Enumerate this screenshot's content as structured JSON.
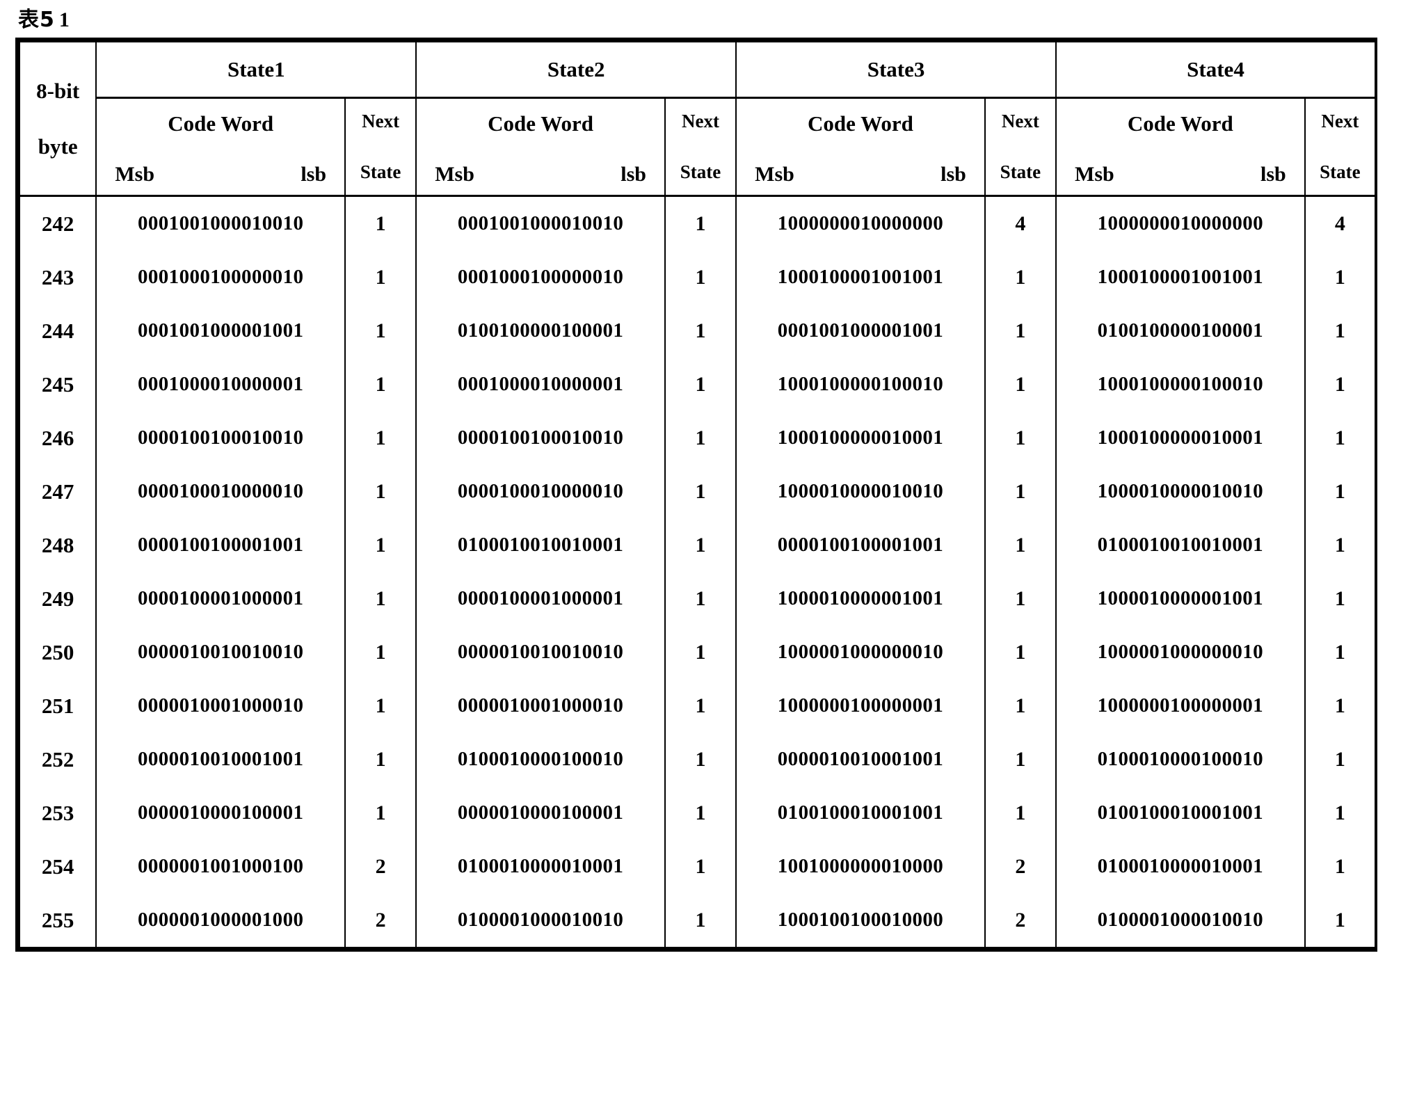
{
  "caption": {
    "label": "表5",
    "number": "1",
    "full": "表 1"
  },
  "table": {
    "corner_header": {
      "line1": "8-bit",
      "line2": "byte"
    },
    "group_headers": [
      "State1",
      "State2",
      "State3",
      "State4"
    ],
    "sub_headers": {
      "code_word": "Code Word",
      "msb": "Msb",
      "lsb": "lsb",
      "next": "Next",
      "state": "State"
    },
    "rows": [
      {
        "byte": "242",
        "cells": [
          {
            "code": "0001001000010010",
            "next": "1"
          },
          {
            "code": "0001001000010010",
            "next": "1"
          },
          {
            "code": "1000000010000000",
            "next": "4"
          },
          {
            "code": "1000000010000000",
            "next": "4"
          }
        ]
      },
      {
        "byte": "243",
        "cells": [
          {
            "code": "0001000100000010",
            "next": "1"
          },
          {
            "code": "0001000100000010",
            "next": "1"
          },
          {
            "code": "1000100001001001",
            "next": "1"
          },
          {
            "code": "1000100001001001",
            "next": "1"
          }
        ]
      },
      {
        "byte": "244",
        "cells": [
          {
            "code": "0001001000001001",
            "next": "1"
          },
          {
            "code": "0100100000100001",
            "next": "1"
          },
          {
            "code": "0001001000001001",
            "next": "1"
          },
          {
            "code": "0100100000100001",
            "next": "1"
          }
        ]
      },
      {
        "byte": "245",
        "cells": [
          {
            "code": "0001000010000001",
            "next": "1"
          },
          {
            "code": "0001000010000001",
            "next": "1"
          },
          {
            "code": "1000100000100010",
            "next": "1"
          },
          {
            "code": "1000100000100010",
            "next": "1"
          }
        ]
      },
      {
        "byte": "246",
        "cells": [
          {
            "code": "0000100100010010",
            "next": "1"
          },
          {
            "code": "0000100100010010",
            "next": "1"
          },
          {
            "code": "1000100000010001",
            "next": "1"
          },
          {
            "code": "1000100000010001",
            "next": "1"
          }
        ]
      },
      {
        "byte": "247",
        "cells": [
          {
            "code": "0000100010000010",
            "next": "1"
          },
          {
            "code": "0000100010000010",
            "next": "1"
          },
          {
            "code": "1000010000010010",
            "next": "1"
          },
          {
            "code": "1000010000010010",
            "next": "1"
          }
        ]
      },
      {
        "byte": "248",
        "cells": [
          {
            "code": "0000100100001001",
            "next": "1"
          },
          {
            "code": "0100010010010001",
            "next": "1"
          },
          {
            "code": "0000100100001001",
            "next": "1"
          },
          {
            "code": "0100010010010001",
            "next": "1"
          }
        ]
      },
      {
        "byte": "249",
        "cells": [
          {
            "code": "0000100001000001",
            "next": "1"
          },
          {
            "code": "0000100001000001",
            "next": "1"
          },
          {
            "code": "1000010000001001",
            "next": "1"
          },
          {
            "code": "1000010000001001",
            "next": "1"
          }
        ]
      },
      {
        "byte": "250",
        "cells": [
          {
            "code": "0000010010010010",
            "next": "1"
          },
          {
            "code": "0000010010010010",
            "next": "1"
          },
          {
            "code": "1000001000000010",
            "next": "1"
          },
          {
            "code": "1000001000000010",
            "next": "1"
          }
        ]
      },
      {
        "byte": "251",
        "cells": [
          {
            "code": "0000010001000010",
            "next": "1"
          },
          {
            "code": "0000010001000010",
            "next": "1"
          },
          {
            "code": "1000000100000001",
            "next": "1"
          },
          {
            "code": "1000000100000001",
            "next": "1"
          }
        ]
      },
      {
        "byte": "252",
        "cells": [
          {
            "code": "0000010010001001",
            "next": "1"
          },
          {
            "code": "0100010000100010",
            "next": "1"
          },
          {
            "code": "0000010010001001",
            "next": "1"
          },
          {
            "code": "0100010000100010",
            "next": "1"
          }
        ]
      },
      {
        "byte": "253",
        "cells": [
          {
            "code": "0000010000100001",
            "next": "1"
          },
          {
            "code": "0000010000100001",
            "next": "1"
          },
          {
            "code": "0100100010001001",
            "next": "1"
          },
          {
            "code": "0100100010001001",
            "next": "1"
          }
        ]
      },
      {
        "byte": "254",
        "cells": [
          {
            "code": "0000001001000100",
            "next": "2"
          },
          {
            "code": "0100010000010001",
            "next": "1"
          },
          {
            "code": "1001000000010000",
            "next": "2"
          },
          {
            "code": "0100010000010001",
            "next": "1"
          }
        ]
      },
      {
        "byte": "255",
        "cells": [
          {
            "code": "0000001000001000",
            "next": "2"
          },
          {
            "code": "0100001000010010",
            "next": "1"
          },
          {
            "code": "1000100100010000",
            "next": "2"
          },
          {
            "code": "0100001000010010",
            "next": "1"
          }
        ]
      }
    ]
  }
}
